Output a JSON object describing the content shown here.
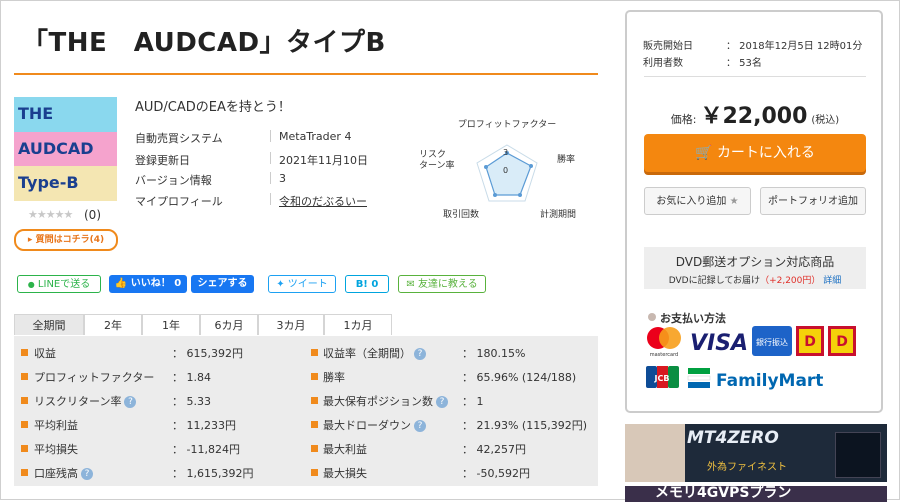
{
  "product": {
    "title": "「THE　AUDCAD」タイプB",
    "thumbnail_lines": [
      "THE",
      "AUDCAD",
      "Type-B"
    ],
    "stars": "★★★★★",
    "rating_count": "(0)",
    "question_button": "質問はコチラ(4)",
    "tagline": "AUD/CADのEAを持とう！",
    "info": [
      {
        "label": "自動売買システム",
        "value": "MetaTrader 4"
      },
      {
        "label": "登録更新日",
        "value": "2021年11月10日"
      },
      {
        "label": "バージョン情報",
        "value": "3"
      },
      {
        "label": "マイプロフィール",
        "value": "令和のだぶるいー"
      }
    ]
  },
  "radar": {
    "axes": [
      "プロフィットファクター",
      "勝率",
      "計測期間",
      "取引回数",
      "リスクリターン率"
    ],
    "scale_labels": [
      "3",
      "0"
    ]
  },
  "share": {
    "line": "LINEで送る",
    "like": "いいね！ 0",
    "fb_share": "シェアする",
    "tweet": "ツイート",
    "hatena": "B! 0",
    "friend": "友達に教える"
  },
  "tabs": [
    "全期間",
    "2年",
    "1年",
    "6カ月",
    "3カ月",
    "1カ月"
  ],
  "stats": [
    {
      "label": "収益",
      "value": "： 615,392円",
      "help": false
    },
    {
      "label": "収益率（全期間）",
      "value": "： 180.15%",
      "help": true
    },
    {
      "label": "プロフィットファクター",
      "value": "： 1.84",
      "help": false
    },
    {
      "label": "勝率",
      "value": "： 65.96% (124/188)",
      "help": false
    },
    {
      "label": "リスクリターン率",
      "value": "： 5.33",
      "help": true
    },
    {
      "label": "最大保有ポジション数",
      "value": "： 1",
      "help": true
    },
    {
      "label": "平均利益",
      "value": "： 11,233円",
      "help": false
    },
    {
      "label": "最大ドローダウン",
      "value": "： 21.93% (115,392円)",
      "help": true
    },
    {
      "label": "平均損失",
      "value": "： -11,824円",
      "help": false
    },
    {
      "label": "最大利益",
      "value": "： 42,257円",
      "help": false
    },
    {
      "label": "口座残高",
      "value": "： 1,615,392円",
      "help": true
    },
    {
      "label": "最大損失",
      "value": "： -50,592円",
      "help": false
    }
  ],
  "sidebar": {
    "sale_start_label": "販売開始日",
    "sale_start_value": "： 2018年12月5日 12時01分",
    "users_label": "利用者数",
    "users_value": "： 53名",
    "price_label": "価格:",
    "price_value": "￥22,000",
    "price_tax": "(税込)",
    "cart_button": "カートに入れる",
    "favorite_button": "お気に入り追加",
    "portfolio_button": "ポートフォリオ追加",
    "dvd_title": "DVD郵送オプション対応商品",
    "dvd_note_a": "DVDに記録してお届け",
    "dvd_note_price": "（+2,200円）",
    "dvd_link": "詳細",
    "payment_title": "お支払い方法",
    "payment_methods": [
      "mastercard",
      "VISA",
      "銀行振込",
      "docomo",
      "Daily",
      "JCB",
      "FamilyMart"
    ]
  },
  "banners": {
    "banner1_title": "MT4ZERO",
    "banner1_sub": "外為ファイネスト",
    "banner2_text": "メモリ4GVPSプラン"
  },
  "colors": {
    "accent": "#f08a1c",
    "stats_bg": "#ececec",
    "cart": "#f4870f",
    "link": "#1a6fc2"
  }
}
